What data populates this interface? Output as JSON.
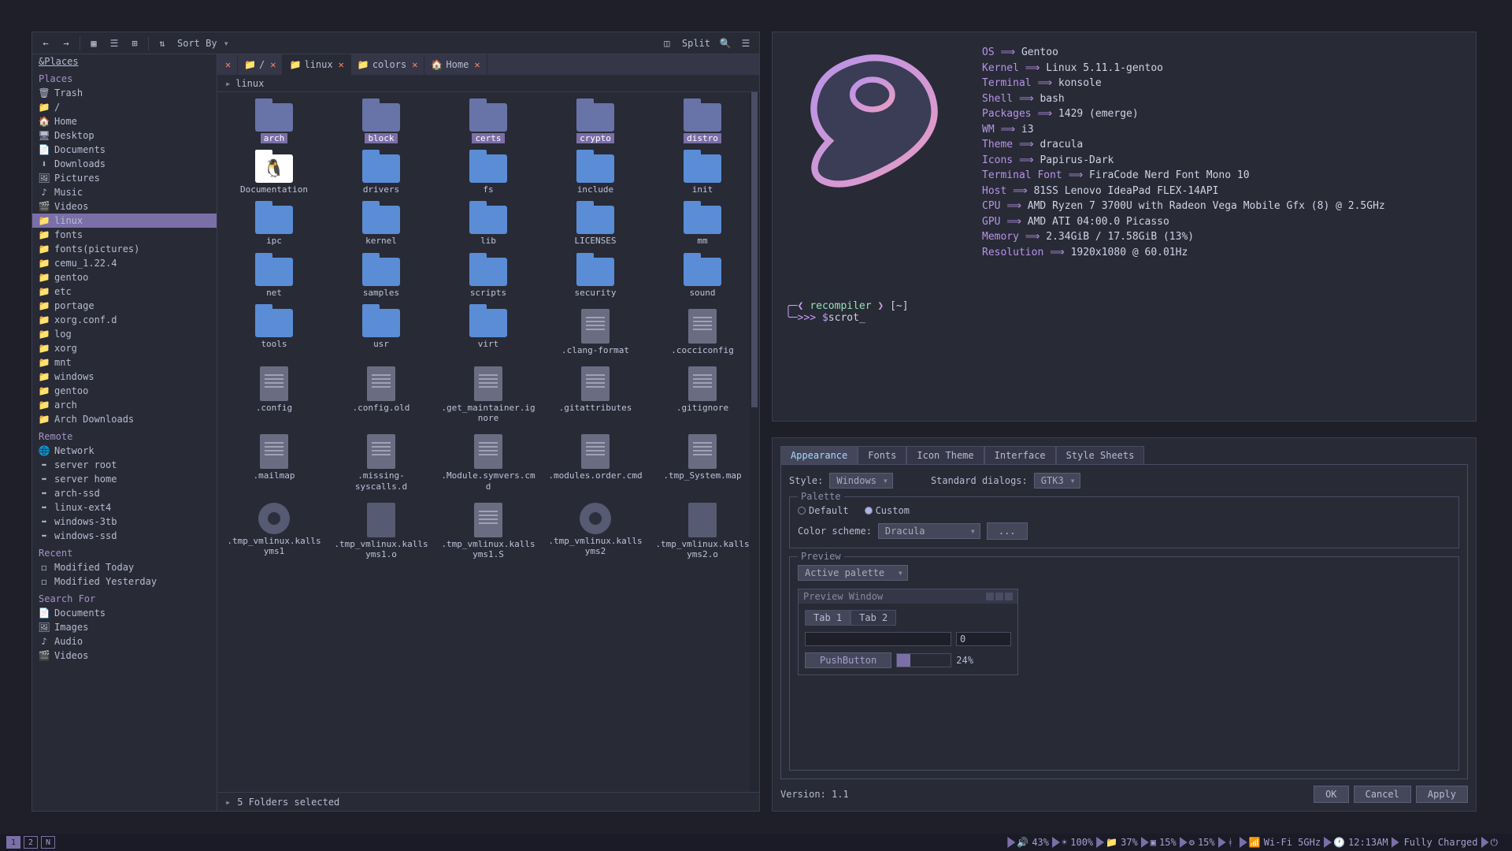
{
  "fm": {
    "toolbar": {
      "sort": "Sort By",
      "split": "Split"
    },
    "sidebar": {
      "placesHeader": "&Places",
      "placesLabel": "Places",
      "remoteLabel": "Remote",
      "recentLabel": "Recent",
      "searchLabel": "Search For",
      "places": [
        {
          "icon": "🗑",
          "label": "Trash"
        },
        {
          "icon": "📁",
          "label": "/",
          "red": true
        },
        {
          "icon": "🏠",
          "label": "Home"
        },
        {
          "icon": "🖥",
          "label": "Desktop"
        },
        {
          "icon": "📄",
          "label": "Documents"
        },
        {
          "icon": "⬇",
          "label": "Downloads"
        },
        {
          "icon": "🖼",
          "label": "Pictures"
        },
        {
          "icon": "♪",
          "label": "Music"
        },
        {
          "icon": "🎬",
          "label": "Videos"
        },
        {
          "icon": "📁",
          "label": "linux",
          "sel": true
        },
        {
          "icon": "📁",
          "label": "fonts"
        },
        {
          "icon": "📁",
          "label": "fonts(pictures)"
        },
        {
          "icon": "📁",
          "label": "cemu_1.22.4"
        },
        {
          "icon": "📁",
          "label": "gentoo"
        },
        {
          "icon": "📁",
          "label": "etc"
        },
        {
          "icon": "📁",
          "label": "portage"
        },
        {
          "icon": "📁",
          "label": "xorg.conf.d"
        },
        {
          "icon": "📁",
          "label": "log"
        },
        {
          "icon": "📁",
          "label": "xorg"
        },
        {
          "icon": "📁",
          "label": "mnt"
        },
        {
          "icon": "📁",
          "label": "windows"
        },
        {
          "icon": "📁",
          "label": "gentoo"
        },
        {
          "icon": "📁",
          "label": "arch"
        },
        {
          "icon": "📁",
          "label": "Arch Downloads"
        }
      ],
      "remote": [
        {
          "icon": "🌐",
          "label": "Network"
        },
        {
          "icon": "⬌",
          "label": "server root"
        },
        {
          "icon": "⬌",
          "label": "server home"
        },
        {
          "icon": "⬌",
          "label": "arch-ssd"
        },
        {
          "icon": "⬌",
          "label": "linux-ext4"
        },
        {
          "icon": "⬌",
          "label": "windows-3tb"
        },
        {
          "icon": "⬌",
          "label": "windows-ssd"
        }
      ],
      "recent": [
        {
          "icon": "◻",
          "label": "Modified Today"
        },
        {
          "icon": "◻",
          "label": "Modified Yesterday"
        }
      ],
      "search": [
        {
          "icon": "📄",
          "label": "Documents"
        },
        {
          "icon": "🖼",
          "label": "Images"
        },
        {
          "icon": "♪",
          "label": "Audio"
        },
        {
          "icon": "🎬",
          "label": "Videos"
        }
      ]
    },
    "tabs": [
      {
        "icon": "📁",
        "label": "/",
        "close": true
      },
      {
        "icon": "📁",
        "label": "linux",
        "close": true,
        "active": true
      },
      {
        "icon": "📁",
        "label": "colors",
        "close": true
      },
      {
        "icon": "🏠",
        "label": "Home",
        "close": true
      }
    ],
    "breadcrumb": "linux",
    "items": [
      {
        "t": "folder",
        "n": "arch",
        "sel": true,
        "dark": true
      },
      {
        "t": "folder",
        "n": "block",
        "sel": true,
        "dark": true
      },
      {
        "t": "folder",
        "n": "certs",
        "sel": true,
        "dark": true
      },
      {
        "t": "folder",
        "n": "crypto",
        "sel": true,
        "dark": true
      },
      {
        "t": "folder",
        "n": "distro",
        "sel": true,
        "dark": true
      },
      {
        "t": "folder",
        "n": "Documentation",
        "tux": true
      },
      {
        "t": "folder",
        "n": "drivers"
      },
      {
        "t": "folder",
        "n": "fs"
      },
      {
        "t": "folder",
        "n": "include"
      },
      {
        "t": "folder",
        "n": "init"
      },
      {
        "t": "folder",
        "n": "ipc"
      },
      {
        "t": "folder",
        "n": "kernel"
      },
      {
        "t": "folder",
        "n": "lib"
      },
      {
        "t": "folder",
        "n": "LICENSES"
      },
      {
        "t": "folder",
        "n": "mm"
      },
      {
        "t": "folder",
        "n": "net"
      },
      {
        "t": "folder",
        "n": "samples"
      },
      {
        "t": "folder",
        "n": "scripts"
      },
      {
        "t": "folder",
        "n": "security"
      },
      {
        "t": "folder",
        "n": "sound"
      },
      {
        "t": "folder",
        "n": "tools"
      },
      {
        "t": "folder",
        "n": "usr"
      },
      {
        "t": "folder",
        "n": "virt"
      },
      {
        "t": "file",
        "n": ".clang-format"
      },
      {
        "t": "file",
        "n": ".cocciconfig"
      },
      {
        "t": "file",
        "n": ".config"
      },
      {
        "t": "file",
        "n": ".config.old"
      },
      {
        "t": "file",
        "n": ".get_maintainer.ignore"
      },
      {
        "t": "file",
        "n": ".gitattributes"
      },
      {
        "t": "file",
        "n": ".gitignore"
      },
      {
        "t": "file",
        "n": ".mailmap"
      },
      {
        "t": "file",
        "n": ".missing-syscalls.d"
      },
      {
        "t": "file",
        "n": ".Module.symvers.cmd"
      },
      {
        "t": "file",
        "n": ".modules.order.cmd"
      },
      {
        "t": "file",
        "n": ".tmp_System.map"
      },
      {
        "t": "gear",
        "n": ".tmp_vmlinux.kallsyms1"
      },
      {
        "t": "bin",
        "n": ".tmp_vmlinux.kallsyms1.o"
      },
      {
        "t": "file",
        "n": ".tmp_vmlinux.kallsyms1.S"
      },
      {
        "t": "gear",
        "n": ".tmp_vmlinux.kallsyms2"
      },
      {
        "t": "bin",
        "n": ".tmp_vmlinux.kallsyms2.o"
      }
    ],
    "status": "5 Folders selected"
  },
  "term": {
    "info": [
      {
        "k": "OS",
        "v": "Gentoo"
      },
      {
        "k": "Kernel",
        "v": "Linux 5.11.1-gentoo"
      },
      {
        "k": "Terminal",
        "v": "konsole"
      },
      {
        "k": "Shell",
        "v": "bash"
      },
      {
        "k": "Packages",
        "v": "1429 (emerge)"
      },
      {
        "k": "WM",
        "v": "i3"
      },
      {
        "k": "Theme",
        "v": "dracula"
      },
      {
        "k": "Icons",
        "v": "Papirus-Dark"
      },
      {
        "k": "Terminal Font",
        "v": "FiraCode Nerd Font Mono 10"
      },
      {
        "k": "Host",
        "v": "81SS Lenovo IdeaPad FLEX-14API"
      },
      {
        "k": "CPU",
        "v": "AMD Ryzen 7 3700U with Radeon Vega Mobile Gfx (8) @ 2.5GHz"
      },
      {
        "k": "GPU",
        "v": "AMD ATI 04:00.0 Picasso"
      },
      {
        "k": "Memory",
        "v": "2.34GiB / 17.58GiB (13%)"
      },
      {
        "k": "Resolution",
        "v": "1920x1080 @ 60.01Hz"
      }
    ],
    "prompt": {
      "user": "recompiler",
      "path": "~",
      "cmd": "scrot"
    }
  },
  "cfg": {
    "tabs": [
      "Appearance",
      "Fonts",
      "Icon Theme",
      "Interface",
      "Style Sheets"
    ],
    "styleLabel": "Style:",
    "styleValue": "Windows",
    "dialogsLabel": "Standard dialogs:",
    "dialogsValue": "GTK3",
    "paletteLabel": "Palette",
    "defaultLabel": "Default",
    "customLabel": "Custom",
    "schemeLabel": "Color scheme:",
    "schemeValue": "Dracula",
    "dotsBtn": "...",
    "previewLabel": "Preview",
    "previewCombo": "Active palette",
    "pw": {
      "title": "Preview Window",
      "tab1": "Tab 1",
      "tab2": "Tab 2",
      "spin": "0",
      "btn": "PushButton",
      "pct": "24%"
    },
    "version": "Version: 1.1",
    "ok": "OK",
    "cancel": "Cancel",
    "apply": "Apply"
  },
  "bar": {
    "ws": [
      "1",
      "2",
      "N"
    ],
    "segs": [
      {
        "icon": "🔊",
        "text": "43%"
      },
      {
        "icon": "☀",
        "text": "100%"
      },
      {
        "icon": "📁",
        "text": "37%"
      },
      {
        "icon": "▣",
        "text": "15%"
      },
      {
        "icon": "⚙",
        "text": "15%"
      },
      {
        "icon": "ᚼ",
        "text": ""
      },
      {
        "icon": "📶",
        "text": "Wi-Fi 5GHz"
      },
      {
        "icon": "🕐",
        "text": "12:13AM"
      },
      {
        "icon": "",
        "text": "Fully Charged"
      },
      {
        "icon": "⏻",
        "text": ""
      }
    ]
  }
}
